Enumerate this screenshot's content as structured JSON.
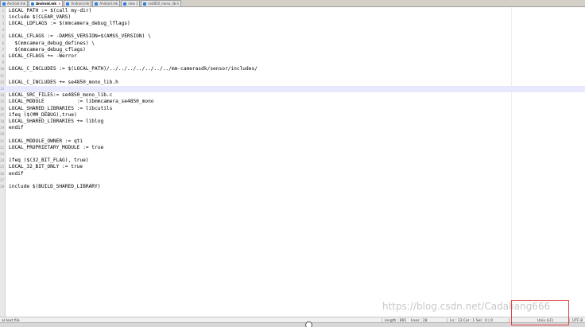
{
  "tabs": [
    {
      "label": "Android.mk",
      "active": false
    },
    {
      "label": "Android.mk",
      "active": true
    },
    {
      "label": "Android.mk",
      "active": false
    },
    {
      "label": "Android.mk",
      "active": false
    },
    {
      "label": "new 1",
      "active": false
    },
    {
      "label": "se4850_mono_lib.h",
      "active": false
    }
  ],
  "editor": {
    "current_line": 13,
    "lines": [
      {
        "n": "1",
        "text": "LOCAL_PATH := $(call my-dir)"
      },
      {
        "n": "2",
        "text": "include $(CLEAR_VARS)"
      },
      {
        "n": "3",
        "text": "LOCAL_LDFLAGS := $(mmcamera_debug_lflags)"
      },
      {
        "n": "4",
        "text": ""
      },
      {
        "n": "5",
        "text": "LOCAL_CFLAGS := -DAMSS_VERSION=$(AMSS_VERSION) \\"
      },
      {
        "n": "6",
        "text": "  $(mmcamera_debug_defines) \\"
      },
      {
        "n": "7",
        "text": "  $(mmcamera_debug_cflags)"
      },
      {
        "n": "8",
        "text": "LOCAL_CFLAGS += -Werror"
      },
      {
        "n": "9",
        "text": ""
      },
      {
        "n": "10",
        "text": "LOCAL_C_INCLUDES := $(LOCAL_PATH)/../../../../../../../mm-camerasdk/sensor/includes/"
      },
      {
        "n": "11",
        "text": ""
      },
      {
        "n": "12",
        "text": "LOCAL_C_INCLUDES += se4850_mono_lib.h"
      },
      {
        "n": "13",
        "text": ""
      },
      {
        "n": "14",
        "text": "LOCAL_SRC_FILES:= se4850_mono_lib.c"
      },
      {
        "n": "15",
        "text": "LOCAL_MODULE           := libmmcamera_se4850_mono"
      },
      {
        "n": "16",
        "text": "LOCAL_SHARED_LIBRARIES := libcutils"
      },
      {
        "n": "17",
        "text": "ifeq ($(MM_DEBUG),true)"
      },
      {
        "n": "18",
        "text": "LOCAL_SHARED_LIBRARIES += liblog"
      },
      {
        "n": "19",
        "text": "endif"
      },
      {
        "n": "20",
        "text": ""
      },
      {
        "n": "21",
        "text": "LOCAL_MODULE_OWNER := qti"
      },
      {
        "n": "22",
        "text": "LOCAL_PROPRIETARY_MODULE := true"
      },
      {
        "n": "23",
        "text": ""
      },
      {
        "n": "24",
        "text": "ifeq ($(32_BIT_FLAG), true)"
      },
      {
        "n": "25",
        "text": "LOCAL_32_BIT_ONLY := true"
      },
      {
        "n": "26",
        "text": "endif"
      },
      {
        "n": "27",
        "text": ""
      },
      {
        "n": "28",
        "text": "include $(BUILD_SHARED_LIBRARY)"
      }
    ]
  },
  "watermark": "https://blog.csdn.net/Cadaliang666",
  "statusbar": {
    "file_type": "al text file",
    "length": "length : 891",
    "lines": "lines : 28",
    "position": "Ln : 13    Col : 1    Sel : 0 | 0",
    "eol": "Unix (LF)",
    "encoding": "UTF-8"
  },
  "colors": {
    "current_line_bg": "#e8e8ff",
    "highlight_box": "#e04040",
    "tab_icon": "#2f7fd8"
  }
}
